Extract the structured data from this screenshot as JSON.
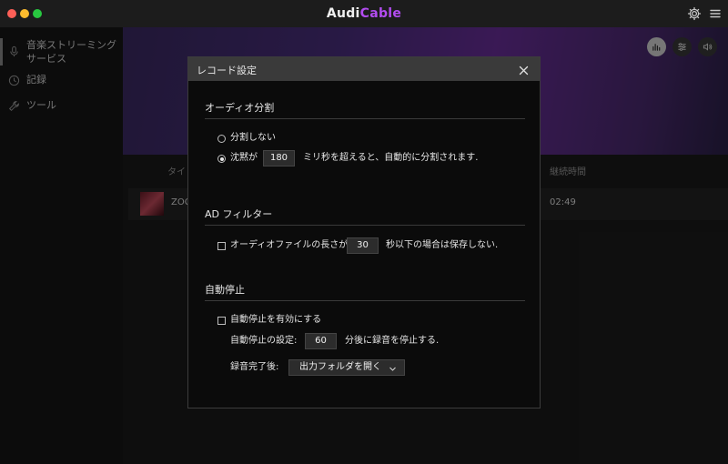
{
  "app": {
    "title_main": "Audi",
    "title_accent": "Cable"
  },
  "sidebar": {
    "items": [
      {
        "label": "音楽ストリーミングサービス",
        "icon": "microphone-icon"
      },
      {
        "label": "記録",
        "icon": "clock-icon"
      },
      {
        "label": "ツール",
        "icon": "wrench-icon"
      }
    ]
  },
  "main": {
    "columns": {
      "title": "タイ",
      "duration": "継続時間"
    },
    "track": {
      "title": "ZOC",
      "duration": "02:49"
    }
  },
  "dialog": {
    "title": "レコード設定",
    "audio_split": {
      "heading": "オーディオ分割",
      "no_split_label": "分割しない",
      "silence_prefix": "沈黙が",
      "silence_value": "180",
      "silence_suffix": "ミリ秒を超えると、自動的に分割されます."
    },
    "ad_filter": {
      "heading": "AD フィルター",
      "prefix": "オーディオファイルの長さが",
      "value": "30",
      "suffix": "秒以下の場合は保存しない."
    },
    "auto_stop": {
      "heading": "自動停止",
      "enable_label": "自動停止を有効にする",
      "setting_label": "自動停止の設定:",
      "setting_value": "60",
      "setting_suffix": "分後に録音を停止する.",
      "after_label": "録音完了後:",
      "after_value": "出力フォルダを開く"
    }
  },
  "colors": {
    "accent": "#b24cf0",
    "banner": "#4a2f7e"
  }
}
